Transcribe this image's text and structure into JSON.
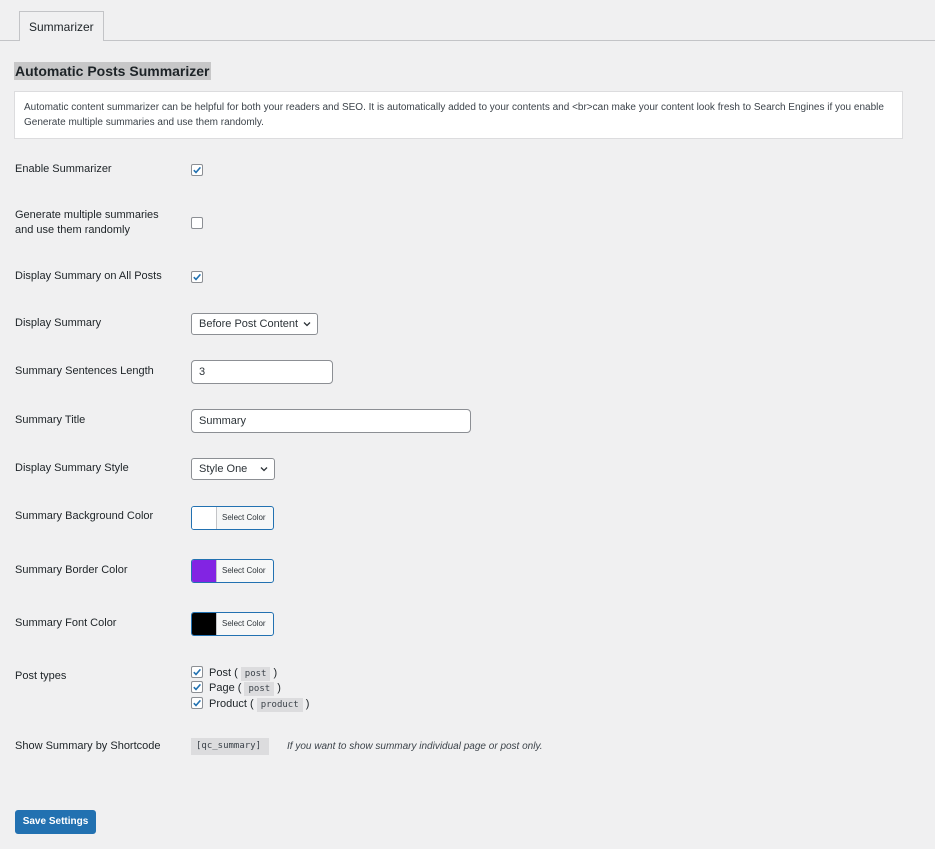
{
  "tabs": [
    {
      "label": "Summarizer",
      "active": true
    }
  ],
  "heading": "Automatic Posts Summarizer",
  "notice": "Automatic content summarizer can be helpful for both your readers and SEO. It is automatically added to your contents and <br>can make your content look fresh to Search Engines if you enable Generate multiple summaries and use them randomly.",
  "fields": {
    "enable_summarizer": {
      "label": "Enable Summarizer",
      "checked": true
    },
    "multiple_summaries": {
      "label_line1": "Generate multiple summaries",
      "label_line2": "and use them randomly",
      "checked": false
    },
    "display_all_posts": {
      "label": "Display Summary on All Posts",
      "checked": true
    },
    "display_summary": {
      "label": "Display Summary",
      "value": "Before Post Content"
    },
    "sentences_length": {
      "label": "Summary Sentences Length",
      "value": "3"
    },
    "summary_title": {
      "label": "Summary Title",
      "value": "Summary"
    },
    "summary_style": {
      "label": "Display Summary Style",
      "value": "Style One"
    },
    "background_color": {
      "label": "Summary Background Color",
      "button": "Select Color",
      "color": "#ffffff"
    },
    "border_color": {
      "label": "Summary Border Color",
      "button": "Select Color",
      "color": "#8224e3"
    },
    "font_color": {
      "label": "Summary Font Color",
      "button": "Select Color",
      "color": "#000000"
    },
    "post_types": {
      "label": "Post types",
      "items": [
        {
          "name": "Post",
          "slug": "post",
          "checked": true
        },
        {
          "name": "Page",
          "slug": "post",
          "checked": true
        },
        {
          "name": "Product",
          "slug": "product",
          "checked": true
        }
      ]
    },
    "shortcode": {
      "label": "Show Summary by Shortcode",
      "code": "[qc_summary]",
      "hint": "If you want to show summary individual page or post only."
    }
  },
  "save_button": "Save Settings",
  "colors": {
    "accent": "#2271b1",
    "background": "#f0f0f1"
  },
  "icons": {
    "checkbox": "checkmark-icon",
    "select": "chevron-down-icon"
  }
}
